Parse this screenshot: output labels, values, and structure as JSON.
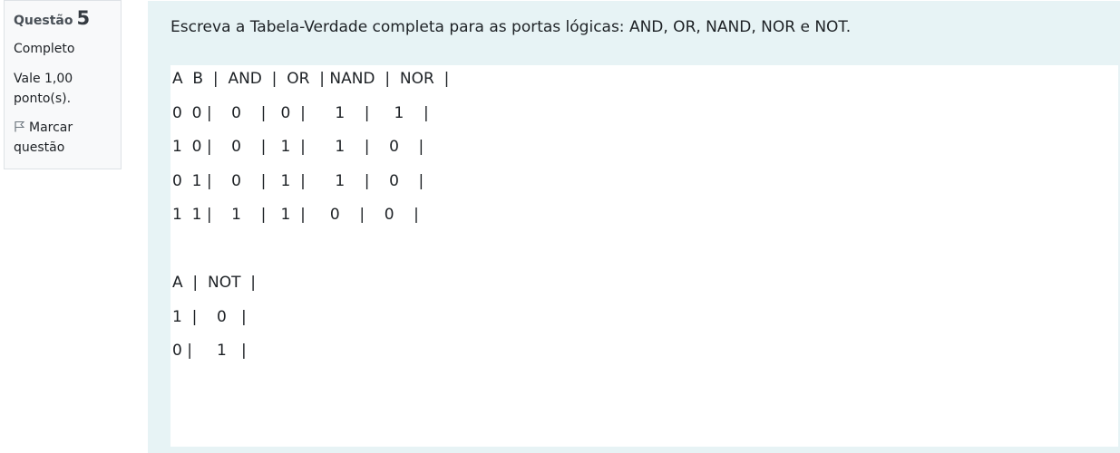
{
  "question_info": {
    "label": "Questão",
    "number": "5",
    "state": "Completo",
    "grade_line1": "Vale 1,00",
    "grade_line2": "ponto(s).",
    "flag_label_line1": "Marcar",
    "flag_label_line2": "questão"
  },
  "question": {
    "text": "Escreva a Tabela-Verdade completa para as portas lógicas: AND, OR, NAND, NOR e NOT."
  },
  "answer": {
    "lines": [
      "A  B  |  AND  |  OR  | NAND  |  NOR  |",
      "0  0 |    0    |   0  |      1    |     1    |",
      "1  0 |    0    |   1  |      1    |    0    |",
      "0  1 |    0    |   1  |      1    |    0    |",
      "1  1 |    1    |   1  |     0    |    0    |",
      "",
      "A  |  NOT  |",
      "1  |    0   |",
      "0 |     1   |"
    ]
  }
}
